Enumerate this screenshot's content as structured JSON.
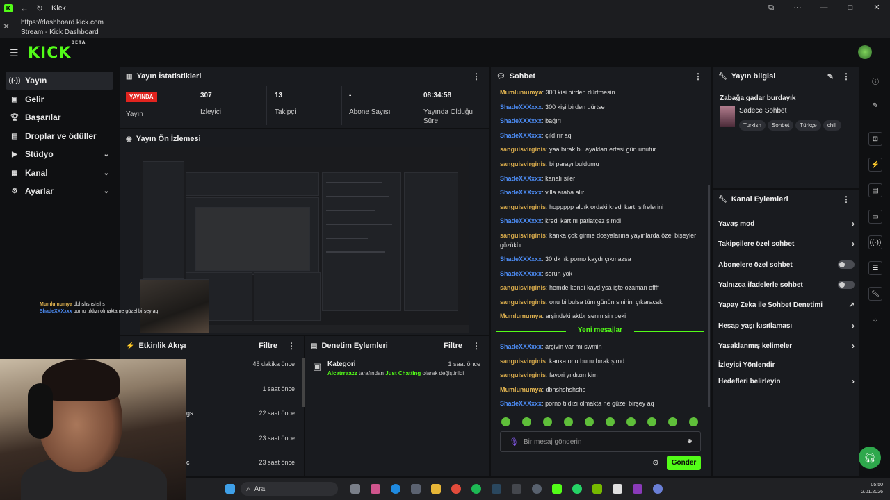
{
  "browser": {
    "tab_title": "Kick",
    "url": "https://dashboard.kick.com",
    "page_title": "Stream - Kick Dashboard"
  },
  "app": {
    "logo": "KICK",
    "logo_sup": "BETA"
  },
  "sidebar": {
    "items": [
      {
        "label": "Yayın",
        "icon": "broadcast-icon",
        "active": true
      },
      {
        "label": "Gelir",
        "icon": "wallet-icon"
      },
      {
        "label": "Başarılar",
        "icon": "trophy-icon"
      },
      {
        "label": "Droplar ve ödüller",
        "icon": "gift-icon"
      },
      {
        "label": "Stüdyo",
        "icon": "video-icon"
      },
      {
        "label": "Kanal",
        "icon": "channel-icon"
      },
      {
        "label": "Ayarlar",
        "icon": "gear-icon"
      }
    ]
  },
  "stats": {
    "title": "Yayın İstatistikleri",
    "live_badge": "YAYINDA",
    "live_label": "Yayın",
    "viewers_value": "307",
    "viewers_label": "İzleyici",
    "followers_value": "13",
    "followers_label": "Takipçi",
    "subs_value": "-",
    "subs_label": "Abone Sayısı",
    "uptime_value": "08:34:58",
    "uptime_label": "Yayında Olduğu Süre"
  },
  "preview": {
    "title": "Yayın Ön İzlemesi"
  },
  "activity": {
    "title": "Etkinlik Akışı",
    "filter": "Filtre",
    "rows": [
      {
        "text": "",
        "time": "45 dakika önce"
      },
      {
        "text": "",
        "time": "1 saat önce"
      },
      {
        "text": "gs",
        "time": "22 saat önce"
      },
      {
        "text": "",
        "time": "23 saat önce"
      },
      {
        "text": "c",
        "time": "23 saat önce"
      }
    ]
  },
  "moderation": {
    "title": "Denetim Eylemleri",
    "filter": "Filtre",
    "item_title": "Kategori",
    "item_time": "1 saat önce",
    "item_user": "Alcatrraazz",
    "item_mid": "tarafından",
    "item_cat": "Just Chatting",
    "item_end": "olarak değiştirildi"
  },
  "chat": {
    "title": "Sohbet",
    "new_messages": "Yeni mesajlar",
    "input_placeholder": "Bir mesaj gönderin",
    "send_label": "Gönder",
    "messages": [
      {
        "user": "Mumlumumya",
        "text": "300 kisi birden dürtmesin",
        "color": "gold"
      },
      {
        "user": "ShadeXXXxxx",
        "text": "300 kişi birden dürtse",
        "color": "blue"
      },
      {
        "user": "ShadeXXXxxx",
        "text": "bağırı",
        "color": "blue"
      },
      {
        "user": "ShadeXXXxxx",
        "text": "çıldırır aq",
        "color": "blue"
      },
      {
        "user": "sanguisvirginis",
        "text": "yaa bırak bu ayakları ertesi gün unutur",
        "color": "yel"
      },
      {
        "user": "sanguisvirginis",
        "text": "bi parayı buldumu",
        "color": "yel"
      },
      {
        "user": "ShadeXXXxxx",
        "text": "kanalı siler",
        "color": "blue"
      },
      {
        "user": "ShadeXXXxxx",
        "text": "villa araba alır",
        "color": "blue"
      },
      {
        "user": "sanguisvirginis",
        "text": "hoppppp aldık ordaki kredi kartı şifrelerini",
        "color": "yel"
      },
      {
        "user": "ShadeXXXxxx",
        "text": "kredi kartını patlatçez şimdi",
        "color": "blue"
      },
      {
        "user": "sanguisvirginis",
        "text": "kanka çok girme dosyalarına yayınlarda özel bişeyler gözükür",
        "color": "yel"
      },
      {
        "user": "ShadeXXXxxx",
        "text": "30 dk lık porno kaydı çıkmazsa",
        "color": "blue"
      },
      {
        "user": "ShadeXXXxxx",
        "text": "sorun yok",
        "color": "blue"
      },
      {
        "user": "sanguisvirginis",
        "text": "hemde kendi kaydıysa işte ozaman offff",
        "color": "yel"
      },
      {
        "user": "sanguisvirginis",
        "text": "onu bi bulsa tüm günün sinirini çıkaracak",
        "color": "yel"
      },
      {
        "user": "Mumlumumya",
        "text": "arşindeki aktör senmisin peki",
        "color": "gold"
      },
      {
        "user": "ShadeXXXxxx",
        "text": "arşivin var mı swmin",
        "color": "blue"
      },
      {
        "user": "sanguisvirginis",
        "text": "kanka onu bunu bırak şimd",
        "color": "yel"
      },
      {
        "user": "sanguisvirginis",
        "text": "favori yıldızın kim",
        "color": "yel"
      },
      {
        "user": "Mumlumumya",
        "text": "dbhshshshshs",
        "color": "gold"
      },
      {
        "user": "ShadeXXXxxx",
        "text": "porno tıldızı olmakta ne güzel birşey aq",
        "color": "blue"
      }
    ]
  },
  "stream_info": {
    "title": "Yayın bilgisi",
    "stream_title": "Zabağa gadar burdayık",
    "category": "Sadece Sohbet",
    "tags": [
      "Turkish",
      "Sohbet",
      "Türkçe",
      "chill"
    ]
  },
  "channel_actions": {
    "title": "Kanal Eylemleri",
    "items": [
      {
        "label": "Yavaş mod",
        "kind": "arrow"
      },
      {
        "label": "Takipçilere özel sohbet",
        "kind": "arrow"
      },
      {
        "label": "Abonelere özel sohbet",
        "kind": "toggle"
      },
      {
        "label": "Yalnızca ifadelerle sohbet",
        "kind": "toggle"
      },
      {
        "label": "Yapay Zeka ile Sohbet Denetimi",
        "kind": "external"
      },
      {
        "label": "Hesap yaşı kısıtlaması",
        "kind": "arrow"
      },
      {
        "label": "Yasaklanmış kelimeler",
        "kind": "arrow"
      },
      {
        "label": "İzleyici Yönlendir",
        "kind": "none"
      },
      {
        "label": "Hedefleri belirleyin",
        "kind": "arrow"
      }
    ]
  },
  "overlay_chat": {
    "line1_user": "Mumlumumya",
    "line1_text": "dbhshshshshs",
    "line2_user": "ShadeXXXxxx",
    "line2_text": "porno tıldızı olmakta ne güzel birşey aq"
  },
  "taskbar": {
    "search": "Ara",
    "time": "05:50",
    "date": "2.01.2026"
  },
  "colors": {
    "accent": "#53fc18",
    "live": "#e2241f",
    "user_blue": "#4d8df6",
    "user_yellow": "#d6a94b"
  }
}
